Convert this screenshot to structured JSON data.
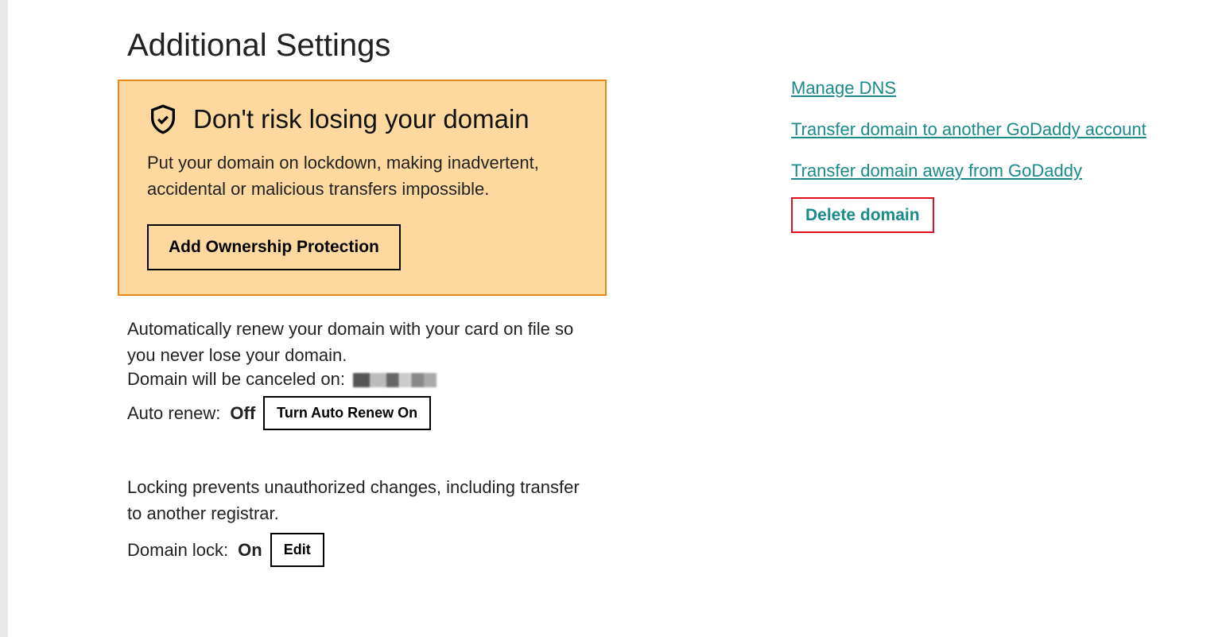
{
  "page": {
    "title": "Additional Settings"
  },
  "warning": {
    "title": "Don't risk losing your domain",
    "description": "Put your domain on lockdown, making inadvertent, accidental or malicious transfers impossible.",
    "button_label": "Add Ownership Protection"
  },
  "auto_renew": {
    "description": "Automatically renew your domain with your card on file so you never lose your domain.",
    "cancel_prefix": "Domain will be canceled on:",
    "cancel_date_redacted": true,
    "label": "Auto renew:",
    "status": "Off",
    "button_label": "Turn Auto Renew On"
  },
  "domain_lock": {
    "description": "Locking prevents unauthorized changes, including transfer to another registrar.",
    "label": "Domain lock:",
    "status": "On",
    "button_label": "Edit"
  },
  "links": {
    "manage_dns": "Manage DNS",
    "transfer_another": "Transfer domain to another GoDaddy account",
    "transfer_away": "Transfer domain away from GoDaddy",
    "delete": "Delete domain"
  }
}
